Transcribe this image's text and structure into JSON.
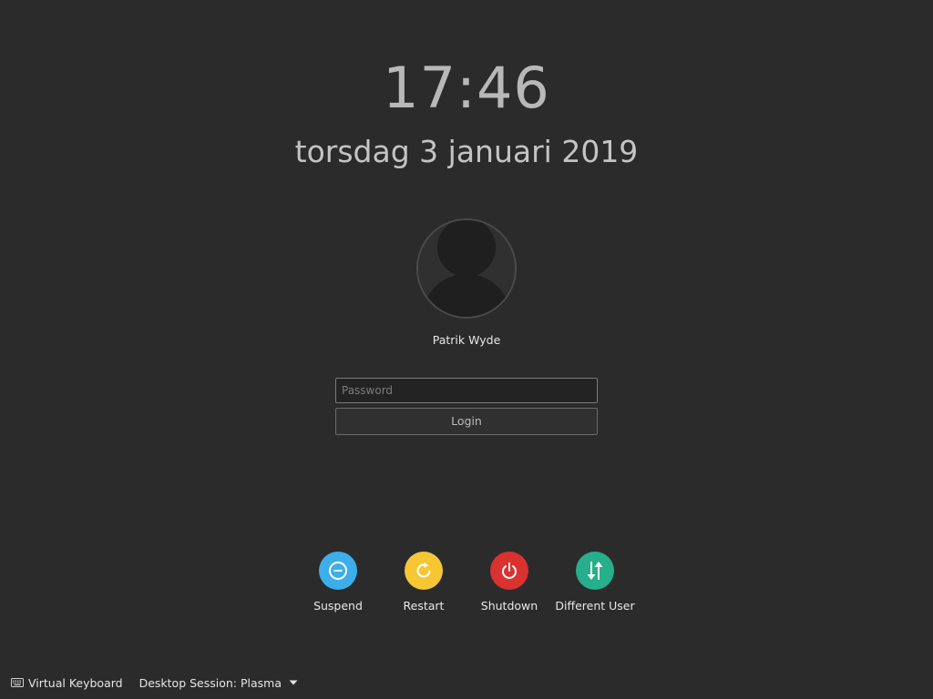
{
  "clock": {
    "time": "17:46",
    "date": "torsdag 3 januari 2019"
  },
  "user": {
    "name": "Patrik Wyde",
    "avatar_icon": "user-silhouette-icon"
  },
  "login_form": {
    "password_placeholder": "Password",
    "password_value": "",
    "login_label": "Login"
  },
  "actions": [
    {
      "label": "Suspend",
      "icon": "suspend-icon",
      "color": "#3daee9"
    },
    {
      "label": "Restart",
      "icon": "restart-icon",
      "color": "#f6c635"
    },
    {
      "label": "Shutdown",
      "icon": "shutdown-icon",
      "color": "#da3131"
    },
    {
      "label": "Different User",
      "icon": "switch-user-icon",
      "color": "#27ae8a"
    }
  ],
  "footer": {
    "virtual_keyboard_label": "Virtual Keyboard",
    "session_label": "Desktop Session: Plasma"
  }
}
